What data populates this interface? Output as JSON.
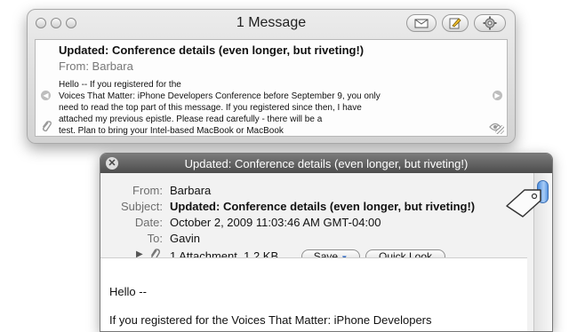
{
  "widget": {
    "title": "1 Message",
    "subject": "Updated: Conference details (even longer, but riveting!)",
    "from": "From: Barbara",
    "body_lines": [
      "Hello --   If you registered for the",
      "Voices That Matter: iPhone Developers Conference before September 9, you only",
      "need to read the top part of this message. If you registered since then, I have",
      "attached my previous epistle. Please read carefully - there will be a",
      "test.   Plan to bring your Intel-based MacBook or MacBook"
    ]
  },
  "message": {
    "title": "Updated: Conference details (even longer, but riveting!)",
    "labels": {
      "from": "From:",
      "subject": "Subject:",
      "date": "Date:",
      "to": "To:"
    },
    "from": "Barbara",
    "subject": "Updated: Conference details (even longer, but riveting!)",
    "date": "October 2, 2009 11:03:46 AM GMT-04:00",
    "to": "Gavin",
    "attachment_summary": "1 Attachment, 1.2 KB",
    "save_label": "Save",
    "quicklook_label": "Quick Look",
    "body_lines": [
      "Hello --",
      "If you registered for the Voices That Matter: iPhone Developers"
    ]
  },
  "colors": {
    "accent_blue": "#4d8fe0",
    "hud_titlebar": "#5a5a5a"
  }
}
